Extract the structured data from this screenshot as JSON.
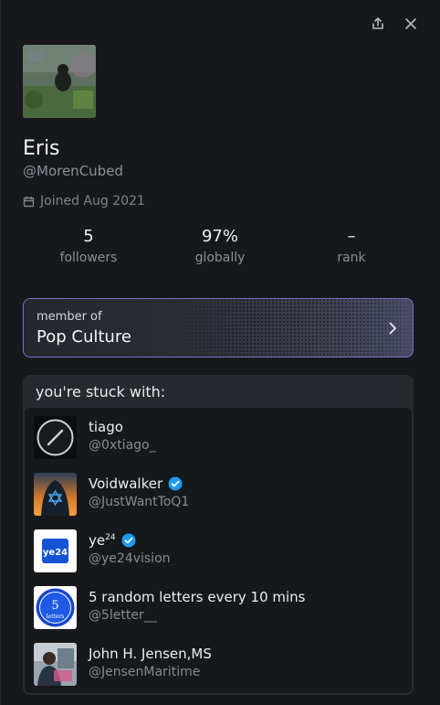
{
  "profile": {
    "name": "Eris",
    "handle": "@MorenCubed",
    "joined": "Joined Aug 2021"
  },
  "stats": [
    {
      "value": "5",
      "label": "followers"
    },
    {
      "value": "97%",
      "label": "globally"
    },
    {
      "value": "–",
      "label": "rank"
    }
  ],
  "membership": {
    "prefix": "member of",
    "group": "Pop Culture"
  },
  "stuck_with": {
    "title": "you're stuck with:",
    "users": [
      {
        "name": "tiago",
        "handle": "@0xtiago_",
        "verified": false
      },
      {
        "name": "Voidwalker",
        "handle": "@JustWantToQ1",
        "verified": true
      },
      {
        "name": "ye",
        "name_sup": "24",
        "handle": "@ye24vision",
        "verified": true
      },
      {
        "name": "5 random letters every 10 mins",
        "handle": "@5letter__",
        "verified": false
      },
      {
        "name": "John H. Jensen,MS",
        "handle": "@JensenMaritime",
        "verified": false
      }
    ]
  },
  "avatar_text": {
    "ye24": "ye24",
    "five_letters": "5",
    "five_letters_sub": "letters"
  },
  "icons": {
    "share": "share-icon",
    "close": "close-icon",
    "calendar": "calendar-icon",
    "chevron": "chevron-right-icon",
    "verified": "verified-badge-icon"
  },
  "colors": {
    "accent_border": "#7b6fc4",
    "verified": "#1d9bf0"
  }
}
